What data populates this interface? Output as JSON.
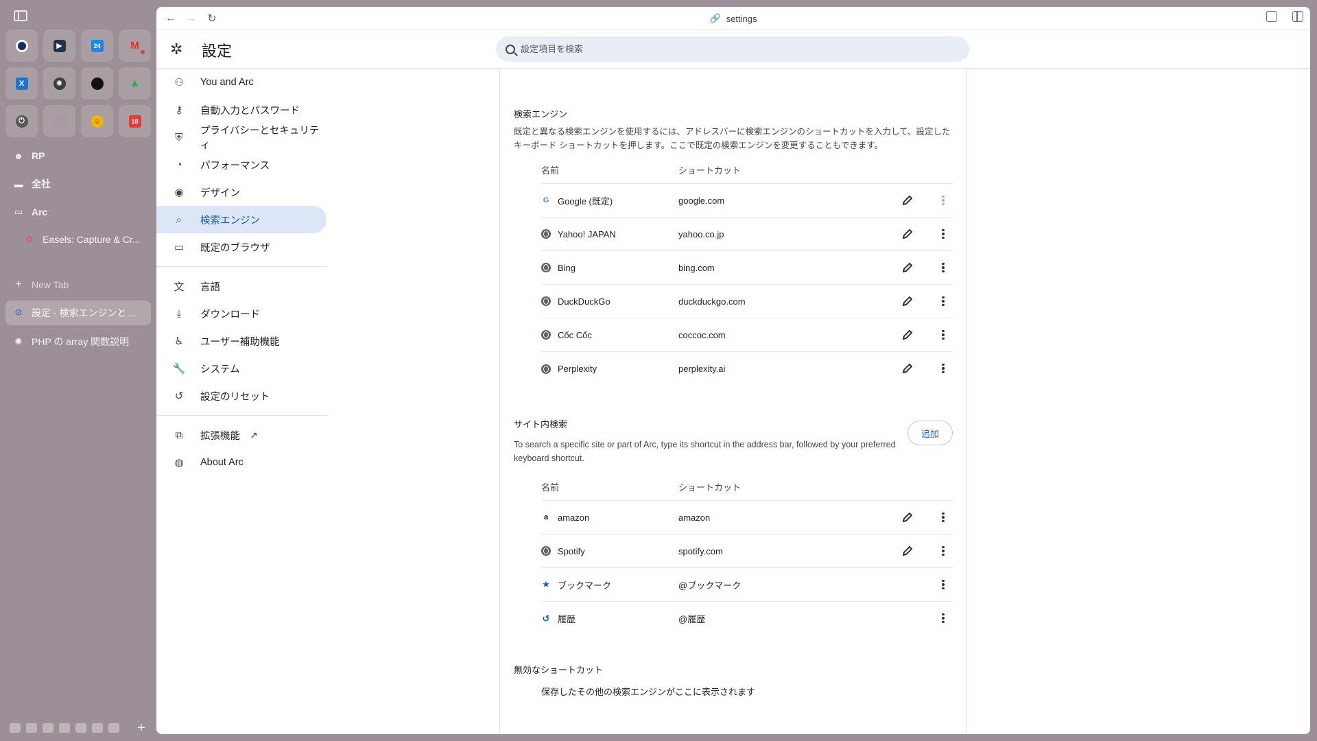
{
  "arc_sidebar": {
    "favorites": [
      {
        "icon": "circle-app-icon",
        "glyph": "●",
        "bg": "#1a2a6c"
      },
      {
        "icon": "play-app-icon",
        "glyph": "▶",
        "bg": "#243447"
      },
      {
        "icon": "calendar-icon",
        "glyph": "24",
        "bg": "#1e88e5"
      },
      {
        "icon": "gmail-icon",
        "glyph": "M",
        "bg": "#d93025"
      },
      {
        "icon": "translate-icon",
        "glyph": "X",
        "bg": "#1976d2"
      },
      {
        "icon": "chatgpt-icon",
        "glyph": "✺",
        "bg": "#3c3c3c"
      },
      {
        "icon": "github-icon",
        "glyph": "●",
        "bg": "#111111"
      },
      {
        "icon": "google-drive-icon",
        "glyph": "▲",
        "bg": "#34a853"
      },
      {
        "icon": "power-icon",
        "glyph": "⏻",
        "bg": "#555555"
      },
      {
        "icon": "blank-app-icon",
        "glyph": "",
        "bg": "#a79aa2"
      },
      {
        "icon": "emoji-icon",
        "glyph": "☺",
        "bg": "#f4b400"
      },
      {
        "icon": "calendar-date-icon",
        "glyph": "18",
        "bg": "#e53935"
      }
    ],
    "spaces": [
      {
        "label": "RP",
        "icon": "person-icon"
      },
      {
        "label": "全社",
        "icon": "folder-icon"
      },
      {
        "label": "Arc",
        "icon": "folder-open-icon"
      }
    ],
    "tab_easels": "Easels: Capture & Cr...",
    "new_tab": "New Tab",
    "tab_settings": "設定 - 検索エンジンとサ...",
    "tab_php": "PHP の array 関数説明"
  },
  "titlebar": {
    "url": "settings"
  },
  "header": {
    "title": "設定",
    "search_placeholder": "設定項目を検索"
  },
  "nav": {
    "items": [
      {
        "label": "You and Arc",
        "icon": "person-icon"
      },
      {
        "label": "自動入力とパスワード",
        "icon": "key-icon"
      },
      {
        "label": "プライバシーとセキュリティ",
        "icon": "shield-icon"
      },
      {
        "label": "パフォーマンス",
        "icon": "speedometer-icon"
      },
      {
        "label": "デザイン",
        "icon": "palette-icon"
      },
      {
        "label": "検索エンジン",
        "icon": "search-icon"
      },
      {
        "label": "既定のブラウザ",
        "icon": "browser-icon"
      },
      {
        "label": "言語",
        "icon": "language-icon"
      },
      {
        "label": "ダウンロード",
        "icon": "download-icon"
      },
      {
        "label": "ユーザー補助機能",
        "icon": "accessibility-icon"
      },
      {
        "label": "システム",
        "icon": "wrench-icon"
      },
      {
        "label": "設定のリセット",
        "icon": "reset-icon"
      },
      {
        "label": "拡張機能",
        "icon": "puzzle-icon"
      },
      {
        "label": "About Arc",
        "icon": "arc-logo-icon"
      }
    ]
  },
  "search_engines": {
    "title": "検索エンジン",
    "desc": "既定と異なる検索エンジンを使用するには、アドレスバーに検索エンジンのショートカットを入力して、設定したキーボード ショートカットを押します。ここで既定の検索エンジンを変更することもできます。",
    "col_name": "名前",
    "col_shortcut": "ショートカット",
    "rows": [
      {
        "name": "Google (既定)",
        "shortcut": "google.com",
        "icon": "google-icon"
      },
      {
        "name": "Yahoo! JAPAN",
        "shortcut": "yahoo.co.jp",
        "icon": "globe-icon"
      },
      {
        "name": "Bing",
        "shortcut": "bing.com",
        "icon": "globe-icon"
      },
      {
        "name": "DuckDuckGo",
        "shortcut": "duckduckgo.com",
        "icon": "globe-icon"
      },
      {
        "name": "Cốc Cốc",
        "shortcut": "coccoc.com",
        "icon": "globe-icon"
      },
      {
        "name": "Perplexity",
        "shortcut": "perplexity.ai",
        "icon": "globe-icon"
      }
    ]
  },
  "site_search": {
    "title": "サイト内検索",
    "desc": "To search a specific site or part of Arc, type its shortcut in the address bar, followed by your preferred keyboard shortcut.",
    "add_label": "追加",
    "col_name": "名前",
    "col_shortcut": "ショートカット",
    "rows": [
      {
        "name": "amazon",
        "shortcut": "amazon",
        "icon": "amazon-icon"
      },
      {
        "name": "Spotify",
        "shortcut": "spotify.com",
        "icon": "globe-icon"
      },
      {
        "name": "ブックマーク",
        "shortcut": "@ブックマーク",
        "icon": "star-icon"
      },
      {
        "name": "履歴",
        "shortcut": "@履歴",
        "icon": "history-icon"
      }
    ]
  },
  "inactive": {
    "title": "無効なショートカット",
    "note": "保存したその他の検索エンジンがここに表示されます"
  },
  "colors": {
    "sidebar_bg": "#9d8f97",
    "accent": "#1b57b8",
    "active_nav_bg": "#dde6f6"
  }
}
